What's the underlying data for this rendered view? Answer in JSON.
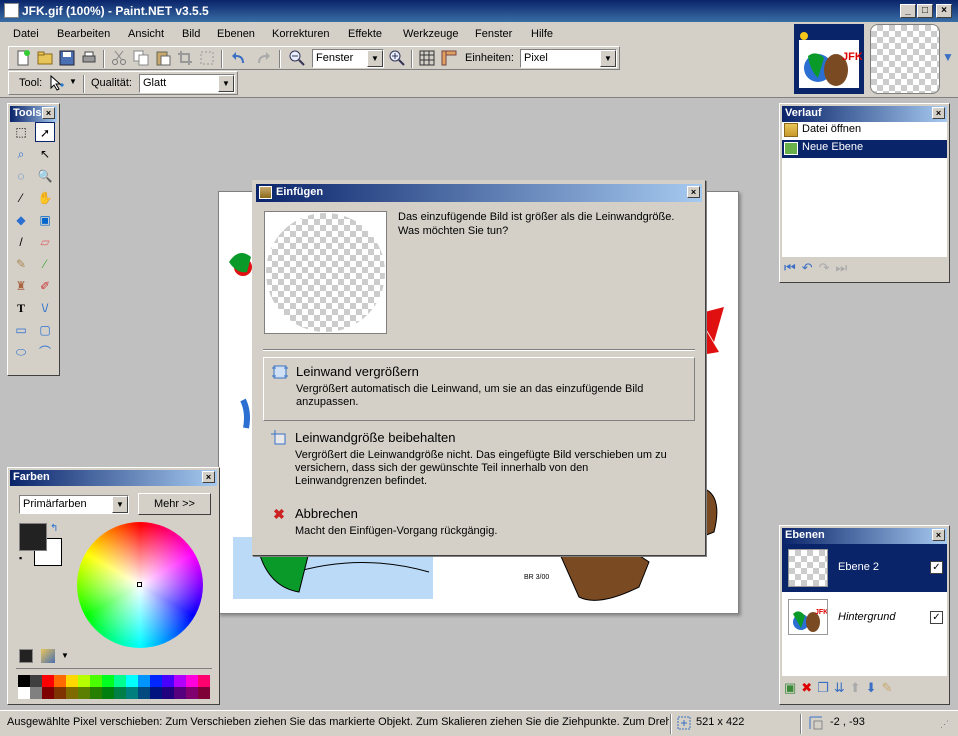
{
  "window": {
    "title": "JFK.gif (100%) - Paint.NET v3.5.5"
  },
  "menu": [
    "Datei",
    "Bearbeiten",
    "Ansicht",
    "Bild",
    "Ebenen",
    "Korrekturen",
    "Effekte",
    "Werkzeuge",
    "Fenster",
    "Hilfe"
  ],
  "toolbar": {
    "zoom_value": "Fenster",
    "units_label": "Einheiten:",
    "units_value": "Pixel",
    "tool_label": "Tool:",
    "quality_label": "Qualität:",
    "quality_value": "Glatt"
  },
  "tools_panel": {
    "title": "Tools"
  },
  "colors_panel": {
    "title": "Farben",
    "mode_value": "Primärfarben",
    "more_button": "Mehr >>",
    "palette": [
      "#000000",
      "#404040",
      "#ff0000",
      "#ff6a00",
      "#ffd800",
      "#b6ff00",
      "#4cff00",
      "#00ff21",
      "#00ff90",
      "#00ffff",
      "#0094ff",
      "#0026ff",
      "#4800ff",
      "#b200ff",
      "#ff00dc",
      "#ff006e",
      "#ffffff",
      "#808080",
      "#7f0000",
      "#7f3300",
      "#7f6a00",
      "#5b7f00",
      "#267f00",
      "#007f0e",
      "#007f46",
      "#007f7f",
      "#004a7f",
      "#00137f",
      "#21007f",
      "#57007f",
      "#7f006e",
      "#7f0037"
    ]
  },
  "history_panel": {
    "title": "Verlauf",
    "items": [
      {
        "label": "Datei öffnen",
        "selected": false
      },
      {
        "label": "Neue Ebene",
        "selected": true
      }
    ]
  },
  "layers_panel": {
    "title": "Ebenen",
    "layers": [
      {
        "name": "Ebene 2",
        "visible": true,
        "selected": true
      },
      {
        "name": "Hintergrund",
        "visible": true,
        "selected": false
      }
    ]
  },
  "dialog": {
    "title": "Einfügen",
    "message": "Das einzufügende Bild ist größer als die Leinwandgröße. Was möchten Sie tun?",
    "options": [
      {
        "title": "Leinwand vergrößern",
        "desc": "Vergrößert automatisch die Leinwand, um sie an das einzufügende Bild anzupassen."
      },
      {
        "title": "Leinwandgröße beibehalten",
        "desc": "Vergrößert die Leinwandgröße nicht. Das eingefügte Bild verschieben um zu versichern, dass sich der gewünschte Teil innerhalb von den Leinwandgrenzen befindet."
      },
      {
        "title": "Abbrechen",
        "desc": "Macht den Einfügen-Vorgang rückgängig."
      }
    ]
  },
  "status": {
    "hint": "Ausgewählte Pixel verschieben: Zum Verschieben ziehen Sie das markierte Objekt. Zum Skalieren ziehen Sie die Ziehpunkte. Zum Drehen c",
    "size": "521 x 422",
    "coords": "-2 , -93"
  },
  "canvas": {
    "artist_signature": "BR 3/00"
  },
  "thumbnail_logo": "JFK"
}
